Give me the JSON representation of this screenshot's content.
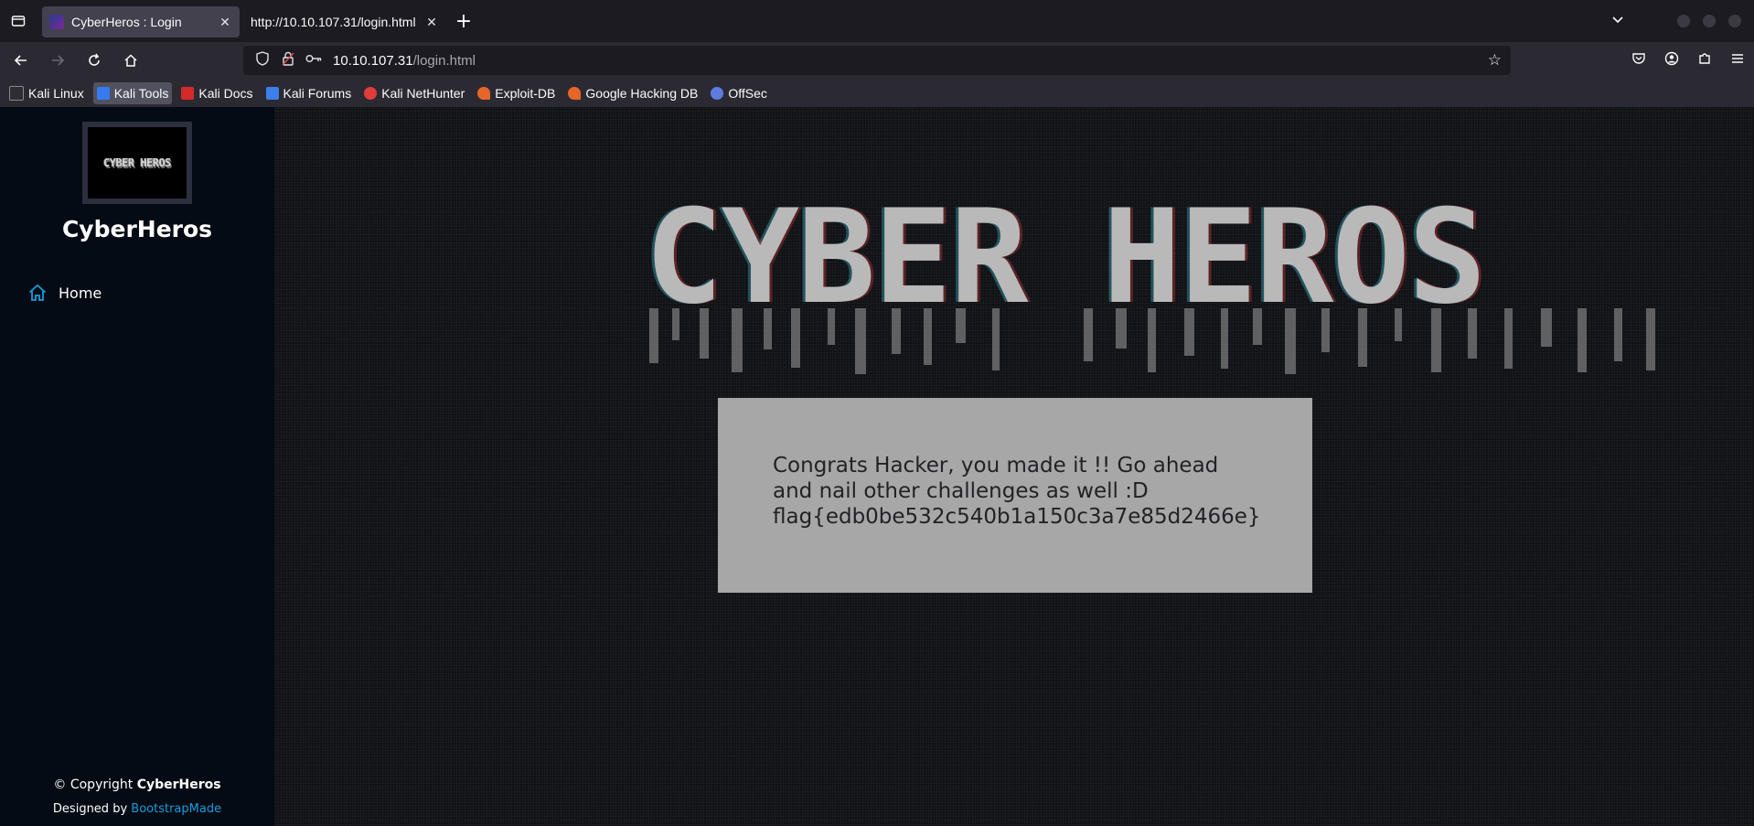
{
  "browser": {
    "tabs": [
      {
        "title": "CyberHeros : Login",
        "active": true
      },
      {
        "title": "http://10.10.107.31/login.html",
        "active": false
      }
    ],
    "url": {
      "host": "10.10.107.31",
      "path": "/login.html"
    },
    "bookmarks": [
      {
        "label": "Kali Linux",
        "color": "#367bf0"
      },
      {
        "label": "Kali Tools",
        "color": "#e33a3a",
        "highlighted": true
      },
      {
        "label": "Kali Docs",
        "color": "#d42a2a"
      },
      {
        "label": "Kali Forums",
        "color": "#3d7ee8"
      },
      {
        "label": "Kali NetHunter",
        "color": "#e03c3c"
      },
      {
        "label": "Exploit-DB",
        "color": "#e8652a"
      },
      {
        "label": "Google Hacking DB",
        "color": "#e8652a"
      },
      {
        "label": "OffSec",
        "color": "#5f7be0"
      }
    ]
  },
  "sidebar": {
    "logo_text": "CYBER HEROS",
    "site_name": "CyberHeros",
    "nav": [
      {
        "label": "Home",
        "icon": "home-icon"
      }
    ],
    "footer": {
      "copyright_prefix": "© Copyright",
      "copyright_brand": "CyberHeros",
      "designed_prefix": "Designed by",
      "designed_link": "BootstrapMade"
    }
  },
  "main": {
    "banner_text": "CYBER HEROS",
    "message": {
      "line1": "Congrats Hacker, you made it !! Go ahead",
      "line2": "and nail other challenges as well :D",
      "flag": "flag{edb0be532c540b1a150c3a7e85d2466e}"
    }
  },
  "colors": {
    "sidebar_bg": "#040b14",
    "accent": "#149ddd",
    "message_bg": "#a7a7a7"
  }
}
